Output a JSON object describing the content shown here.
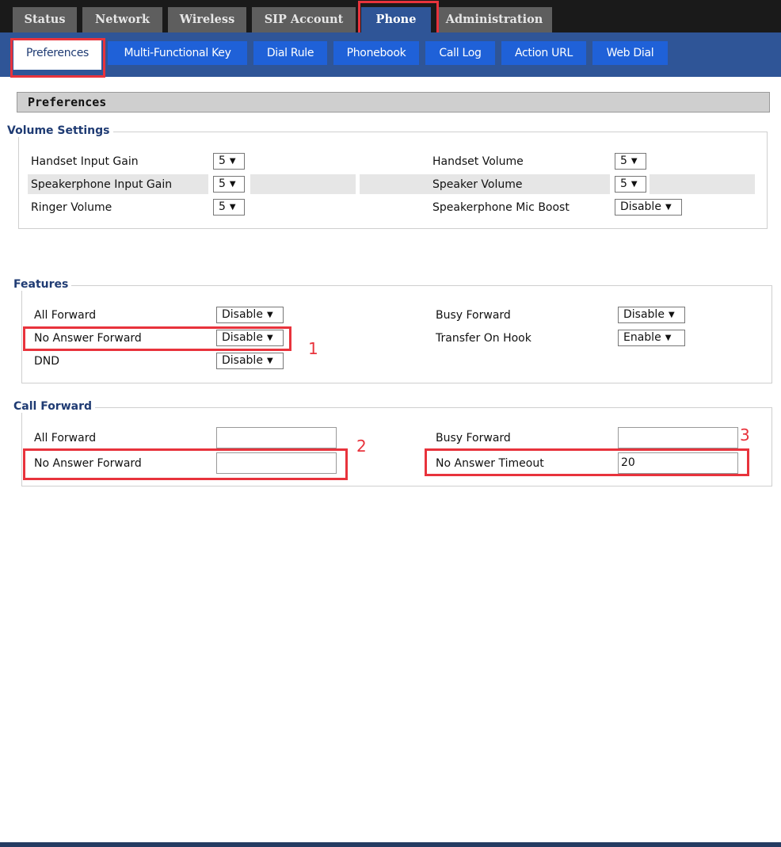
{
  "top_tabs": [
    "Status",
    "Network",
    "Wireless",
    "SIP Account",
    "Phone",
    "Administration"
  ],
  "sub_tabs": [
    "Preferences",
    "Multi-Functional Key",
    "Dial Rule",
    "Phonebook",
    "Call Log",
    "Action URL",
    "Web Dial"
  ],
  "section_title": "Preferences",
  "volume": {
    "legend": "Volume Settings",
    "handset_input_gain": {
      "label": "Handset Input Gain",
      "value": "5"
    },
    "handset_volume": {
      "label": "Handset Volume",
      "value": "5"
    },
    "speakerphone_input_gain": {
      "label": "Speakerphone Input Gain",
      "value": "5"
    },
    "speaker_volume": {
      "label": "Speaker Volume",
      "value": "5"
    },
    "ringer_volume": {
      "label": "Ringer Volume",
      "value": "5"
    },
    "speakerphone_mic_boost": {
      "label": "Speakerphone Mic Boost",
      "value": "Disable"
    }
  },
  "features": {
    "legend": "Features",
    "all_forward": {
      "label": "All Forward",
      "value": "Disable"
    },
    "busy_forward": {
      "label": "Busy Forward",
      "value": "Disable"
    },
    "no_answer_forward": {
      "label": "No Answer Forward",
      "value": "Disable"
    },
    "transfer_on_hook": {
      "label": "Transfer On Hook",
      "value": "Enable"
    },
    "dnd": {
      "label": "DND",
      "value": "Disable"
    }
  },
  "call_forward": {
    "legend": "Call Forward",
    "all_forward": {
      "label": "All Forward",
      "value": ""
    },
    "busy_forward": {
      "label": "Busy Forward",
      "value": ""
    },
    "no_answer_forward": {
      "label": "No Answer Forward",
      "value": ""
    },
    "no_answer_timeout": {
      "label": "No Answer Timeout",
      "value": "20"
    }
  },
  "annotations": [
    "1",
    "2",
    "3"
  ],
  "colors": {
    "highlight": "#e8333c",
    "nav_blue": "#2f5597",
    "tab_blue": "#1f61d8"
  }
}
